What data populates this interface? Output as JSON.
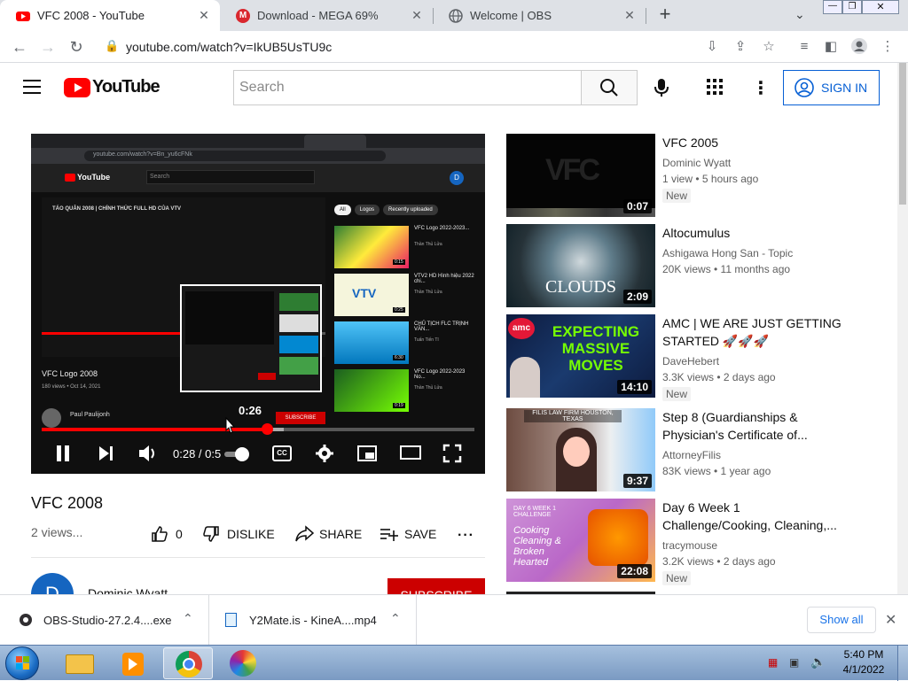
{
  "browser": {
    "tabs": [
      {
        "title": "VFC 2008 - YouTube",
        "active": true,
        "favicon_color": "#ff0000"
      },
      {
        "title": "Download - MEGA 69%",
        "active": false,
        "favicon_color": "#d9272e"
      },
      {
        "title": "Welcome | OBS",
        "active": false,
        "favicon_color": "#5f6368"
      }
    ],
    "new_tab": "+",
    "url": "youtube.com/watch?v=IkUB5UsTU9c"
  },
  "youtube": {
    "logo_text": "YouTube",
    "search_placeholder": "Search",
    "sign_in": "SIGN IN",
    "video": {
      "title": "VFC 2008",
      "views": "2 views...",
      "likes": "0",
      "dislike": "DISLIKE",
      "share": "SHARE",
      "save": "SAVE",
      "channel_initial": "D",
      "channel_name": "Dominic Wyatt",
      "subscribe": "SUBSCRIBE",
      "time": "0:28 / 0:5",
      "hover_time": "0:26",
      "progress": 0.52,
      "buffered": 0.56
    },
    "inner_screen": {
      "title": "TÁO QUÂN 2008 | CHÍNH THỨC FULL HD CỦA VTV",
      "logo": "YouTube",
      "search": "Search",
      "video_title": "VFC Logo 2008",
      "video_meta": "180 views • Oct 14, 2021",
      "channel": "Paul Paulijonh",
      "subscribe": "SUBSCRIBE",
      "chips": [
        "All",
        "Logos",
        "Recently uploaded"
      ],
      "recs": [
        {
          "title": "VFC Logo 2022-2023...",
          "meta": "Thần Thủ Lửa",
          "dur": "0:15"
        },
        {
          "title": "VTV2 HD Hình hiệu 2022 chi...",
          "meta": "Thần Thủ Lửa",
          "dur": "0:25"
        },
        {
          "title": "CHỦ TỊCH FLC TRỊNH VĂN...",
          "meta": "Tuấn Tiến TI",
          "dur": "6:30"
        },
        {
          "title": "VFC Logo 2022-2023 No...",
          "meta": "Thần Thủ Lửa",
          "dur": "0:19"
        }
      ],
      "url": "youtube.com/watch?v=Bn_yu6cFNk"
    },
    "recommendations": [
      {
        "title": "VFC 2005",
        "channel": "Dominic Wyatt",
        "meta": "1 view • 5 hours ago",
        "badge": "New",
        "duration": "0:07",
        "thumb_caption": "VFC"
      },
      {
        "title": "Altocumulus",
        "channel": "Ashigawa Hong San - Topic",
        "meta": "20K views • 11 months ago",
        "badge": "",
        "duration": "2:09",
        "thumb_caption": "CLOUDS"
      },
      {
        "title": "AMC | WE ARE JUST GETTING STARTED 🚀🚀🚀",
        "channel": "DaveHebert",
        "meta": "3.3K views • 2 days ago",
        "badge": "New",
        "duration": "14:10",
        "thumb_caption": "EXPECTING MASSIVE MOVES",
        "thumb_brand": "amc"
      },
      {
        "title": "Step 8 (Guardianships & Physician's Certificate of...",
        "channel": "AttorneyFilis",
        "meta": "83K views • 1 year ago",
        "badge": "",
        "duration": "9:37",
        "thumb_caption": "FILIS LAW FIRM HOUSTON, TEXAS"
      },
      {
        "title": "Day 6 Week 1 Challenge/Cooking, Cleaning,...",
        "channel": "tracymouse",
        "meta": "3.2K views • 2 days ago",
        "badge": "New",
        "duration": "22:08",
        "thumb_caption": "Cooking Cleaning & Broken Hearted",
        "thumb_top": "DAY 6 WEEK 1 CHALLENGE"
      }
    ]
  },
  "downloads": {
    "items": [
      {
        "name": "OBS-Studio-27.2.4....exe"
      },
      {
        "name": "Y2Mate.is - KineA....mp4"
      }
    ],
    "show_all": "Show all"
  },
  "taskbar": {
    "time": "5:40 PM",
    "date": "4/1/2022"
  }
}
